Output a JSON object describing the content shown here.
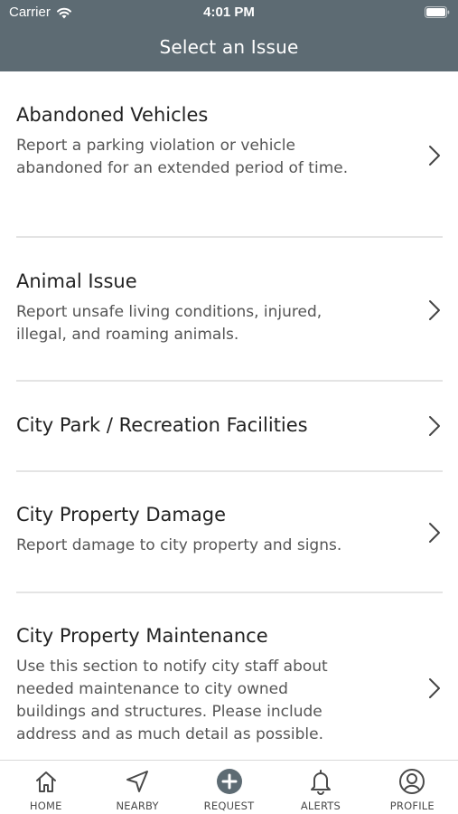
{
  "status_bar": {
    "carrier": "Carrier",
    "time": "4:01 PM"
  },
  "header": {
    "title": "Select an Issue",
    "background_color": "#5d6b73"
  },
  "issues": [
    {
      "title": "Abandoned Vehicles",
      "description": "Report a parking violation or vehicle abandoned for an extended period of time."
    },
    {
      "title": "Animal Issue",
      "description": "Report unsafe living conditions, injured, illegal, and roaming animals."
    },
    {
      "title": "City Park / Recreation Facilities",
      "description": ""
    },
    {
      "title": "City Property Damage",
      "description": "Report damage to city property and signs."
    },
    {
      "title": "City Property Maintenance",
      "description": "Use this section to notify city staff about needed maintenance to city owned buildings and structures. Please include address and as much detail as  possible."
    }
  ],
  "tabbar": {
    "items": [
      {
        "label": "HOME",
        "icon": "home-icon"
      },
      {
        "label": "NEARBY",
        "icon": "navigation-arrow-icon"
      },
      {
        "label": "REQUEST",
        "icon": "plus-circle-icon"
      },
      {
        "label": "ALERTS",
        "icon": "bell-icon"
      },
      {
        "label": "PROFILE",
        "icon": "user-circle-icon"
      }
    ]
  }
}
